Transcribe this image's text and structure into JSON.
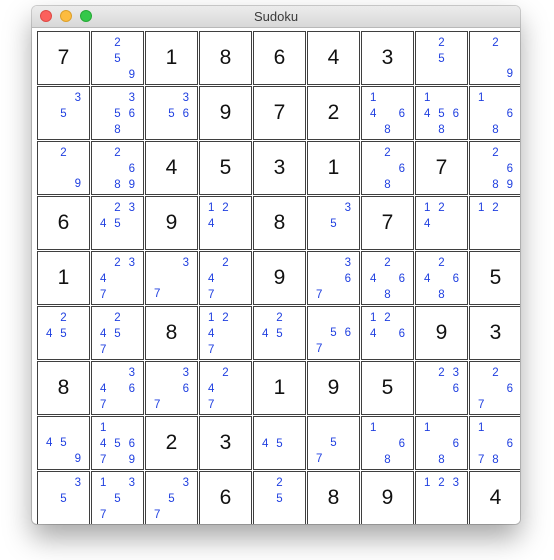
{
  "window": {
    "title": "Sudoku"
  },
  "board": [
    [
      {
        "v": "7"
      },
      {
        "c": [
          2,
          5,
          9
        ]
      },
      {
        "v": "1"
      },
      {
        "v": "8"
      },
      {
        "v": "6"
      },
      {
        "v": "4"
      },
      {
        "v": "3"
      },
      {
        "c": [
          2,
          5
        ]
      },
      {
        "c": [
          2,
          9
        ]
      }
    ],
    [
      {
        "c": [
          3,
          5
        ]
      },
      {
        "c": [
          3,
          5,
          6,
          8
        ]
      },
      {
        "c": [
          3,
          5,
          6
        ]
      },
      {
        "v": "9"
      },
      {
        "v": "7"
      },
      {
        "v": "2"
      },
      {
        "c": [
          1,
          4,
          6,
          8
        ]
      },
      {
        "c": [
          1,
          4,
          5,
          6,
          8
        ]
      },
      {
        "c": [
          1,
          6,
          8
        ]
      }
    ],
    [
      {
        "c": [
          2,
          9
        ]
      },
      {
        "c": [
          2,
          6,
          8,
          9
        ]
      },
      {
        "v": "4"
      },
      {
        "v": "5"
      },
      {
        "v": "3"
      },
      {
        "v": "1"
      },
      {
        "c": [
          2,
          6,
          8
        ]
      },
      {
        "v": "7"
      },
      {
        "c": [
          2,
          6,
          8,
          9
        ]
      }
    ],
    [
      {
        "v": "6"
      },
      {
        "c": [
          2,
          3,
          4,
          5
        ]
      },
      {
        "v": "9"
      },
      {
        "c": [
          1,
          2,
          4
        ]
      },
      {
        "v": "8"
      },
      {
        "c": [
          3,
          5
        ]
      },
      {
        "v": "7"
      },
      {
        "c": [
          1,
          2,
          4
        ]
      },
      {
        "c": [
          1,
          2
        ]
      }
    ],
    [
      {
        "v": "1"
      },
      {
        "c": [
          2,
          3,
          4,
          7
        ]
      },
      {
        "c": [
          3,
          7
        ]
      },
      {
        "c": [
          2,
          4,
          7
        ]
      },
      {
        "v": "9"
      },
      {
        "c": [
          3,
          6,
          7
        ]
      },
      {
        "c": [
          2,
          4,
          6,
          8
        ]
      },
      {
        "c": [
          2,
          4,
          6,
          8
        ]
      },
      {
        "v": "5"
      }
    ],
    [
      {
        "c": [
          2,
          4,
          5
        ]
      },
      {
        "c": [
          2,
          4,
          5,
          7
        ]
      },
      {
        "v": "8"
      },
      {
        "c": [
          1,
          2,
          4,
          7
        ]
      },
      {
        "c": [
          2,
          4,
          5
        ]
      },
      {
        "c": [
          5,
          6,
          7
        ]
      },
      {
        "c": [
          1,
          2,
          4,
          6
        ]
      },
      {
        "v": "9"
      },
      {
        "v": "3"
      }
    ],
    [
      {
        "v": "8"
      },
      {
        "c": [
          3,
          4,
          6,
          7
        ]
      },
      {
        "c": [
          3,
          6,
          7
        ]
      },
      {
        "c": [
          2,
          4,
          7
        ]
      },
      {
        "v": "1"
      },
      {
        "v": "9"
      },
      {
        "v": "5"
      },
      {
        "c": [
          2,
          3,
          6
        ]
      },
      {
        "c": [
          2,
          6,
          7
        ]
      }
    ],
    [
      {
        "c": [
          4,
          5,
          9
        ]
      },
      {
        "c": [
          1,
          4,
          5,
          6,
          7,
          9
        ]
      },
      {
        "v": "2"
      },
      {
        "v": "3"
      },
      {
        "c": [
          4,
          5
        ]
      },
      {
        "c": [
          5,
          7
        ]
      },
      {
        "c": [
          1,
          6,
          8
        ]
      },
      {
        "c": [
          1,
          6,
          8
        ]
      },
      {
        "c": [
          1,
          6,
          7,
          8
        ]
      }
    ],
    [
      {
        "c": [
          3,
          5
        ]
      },
      {
        "c": [
          1,
          3,
          5,
          7
        ]
      },
      {
        "c": [
          3,
          5,
          7
        ]
      },
      {
        "v": "6"
      },
      {
        "c": [
          2,
          5
        ]
      },
      {
        "v": "8"
      },
      {
        "v": "9"
      },
      {
        "c": [
          1,
          2,
          3
        ]
      },
      {
        "v": "4"
      }
    ]
  ]
}
